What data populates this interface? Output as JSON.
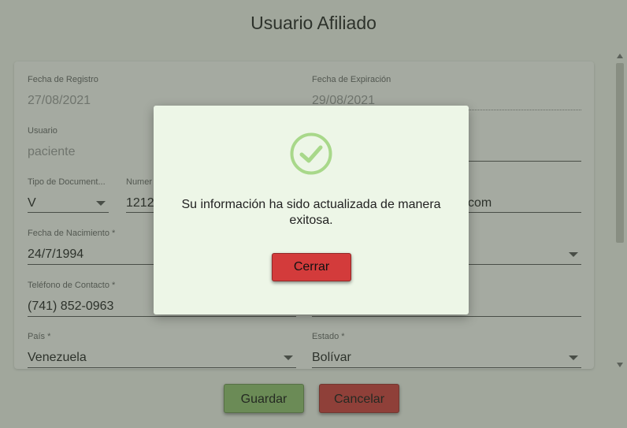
{
  "dialog": {
    "title": "Usuario Afiliado"
  },
  "form": {
    "fecha_registro": {
      "label": "Fecha de Registro",
      "value": "27/08/2021"
    },
    "fecha_expiracion": {
      "label": "Fecha de Expiración",
      "value": "29/08/2021"
    },
    "usuario": {
      "label": "Usuario",
      "value": "paciente"
    },
    "tipo_documento": {
      "label": "Tipo de Document...",
      "value": "V"
    },
    "numero_documento": {
      "label": "Numer",
      "value": "1212"
    },
    "email": {
      "value": "com"
    },
    "fecha_nacimiento": {
      "label": "Fecha de Nacimiento *",
      "value": "24/7/1994"
    },
    "telefono": {
      "label": "Teléfono de Contacto *",
      "value": "(741) 852-0963"
    },
    "pais": {
      "label": "País *",
      "value": "Venezuela"
    },
    "estado": {
      "label": "Estado *",
      "value": "Bolívar"
    }
  },
  "actions": {
    "save_label": "Guardar",
    "cancel_label": "Cancelar"
  },
  "modal": {
    "icon": "check-circle-icon",
    "message": "Su información ha sido actualizada de manera exitosa.",
    "close_label": "Cerrar"
  },
  "colors": {
    "success": "#92c36f",
    "danger": "#d33b3b",
    "modal_bg": "#edf6e7",
    "check": "#a8d88a"
  }
}
